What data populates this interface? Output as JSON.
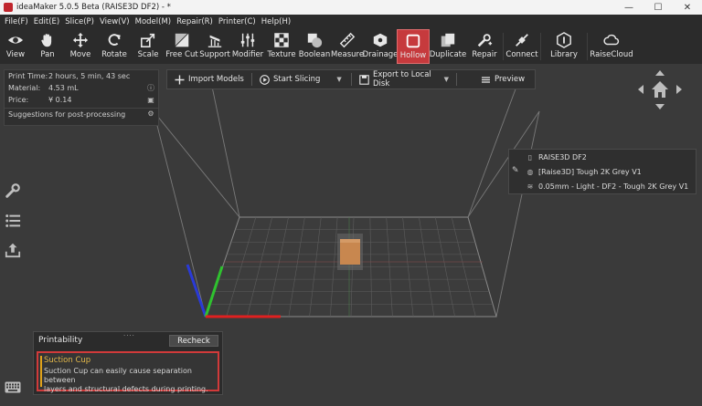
{
  "window": {
    "title": "ideaMaker 5.0.5 Beta (RAISE3D DF2) - *",
    "controls": [
      "—",
      "☐",
      "✕"
    ]
  },
  "menu": [
    "File(F)",
    "Edit(E)",
    "Slice(P)",
    "View(V)",
    "Model(M)",
    "Repair(R)",
    "Printer(C)",
    "Help(H)"
  ],
  "toolbar": [
    {
      "label": "View",
      "icon": "eye-icon"
    },
    {
      "label": "Pan",
      "icon": "hand-icon"
    },
    {
      "label": "Move",
      "icon": "move-icon"
    },
    {
      "label": "Rotate",
      "icon": "rotate-icon"
    },
    {
      "label": "Scale",
      "icon": "scale-icon"
    },
    {
      "label": "Free Cut",
      "icon": "cut-icon"
    },
    {
      "label": "Support",
      "icon": "support-icon"
    },
    {
      "label": "Modifier",
      "icon": "sliders-icon"
    },
    {
      "label": "Texture",
      "icon": "texture-icon"
    },
    {
      "label": "Boolean",
      "icon": "boolean-icon"
    },
    {
      "label": "Measure",
      "icon": "ruler-icon"
    },
    {
      "label": "Drainage",
      "icon": "drainage-icon"
    },
    {
      "label": "Hollow",
      "icon": "hollow-icon",
      "active": true
    },
    {
      "label": "Duplicate",
      "icon": "duplicate-icon"
    },
    {
      "label": "Repair",
      "icon": "wrench-plus-icon"
    },
    {
      "label": "Connect",
      "icon": "connect-icon"
    },
    {
      "label": "Library",
      "icon": "library-icon"
    },
    {
      "label": "RaiseCloud",
      "icon": "cloud-icon"
    }
  ],
  "info": {
    "print_time_label": "Print Time:",
    "print_time_value": "2 hours, 5 min, 43 sec",
    "material_label": "Material:",
    "material_value": "4.53 mL",
    "price_label": "Price:",
    "price_value": "¥  0.14",
    "suggestions": "Suggestions for post-processing"
  },
  "actions": {
    "import": "Import Models",
    "slice": "Start Slicing",
    "export": "Export to Local Disk",
    "preview": "Preview"
  },
  "printer": {
    "name": "RAISE3D DF2",
    "material": "[Raise3D] Tough 2K Grey V1",
    "profile": "0.05mm - Light - DF2 - Tough 2K Grey V1"
  },
  "printability": {
    "title": "Printability",
    "recheck": "Recheck",
    "issue_title": "Suction Cup",
    "issue_desc_line1": "Suction Cup can easily cause separation between",
    "issue_desc_line2": "layers and structural defects during printing."
  },
  "colors": {
    "accent_red": "#c63a3d",
    "warning_yellow": "#e3b84a",
    "model_orange": "#c8874f"
  }
}
